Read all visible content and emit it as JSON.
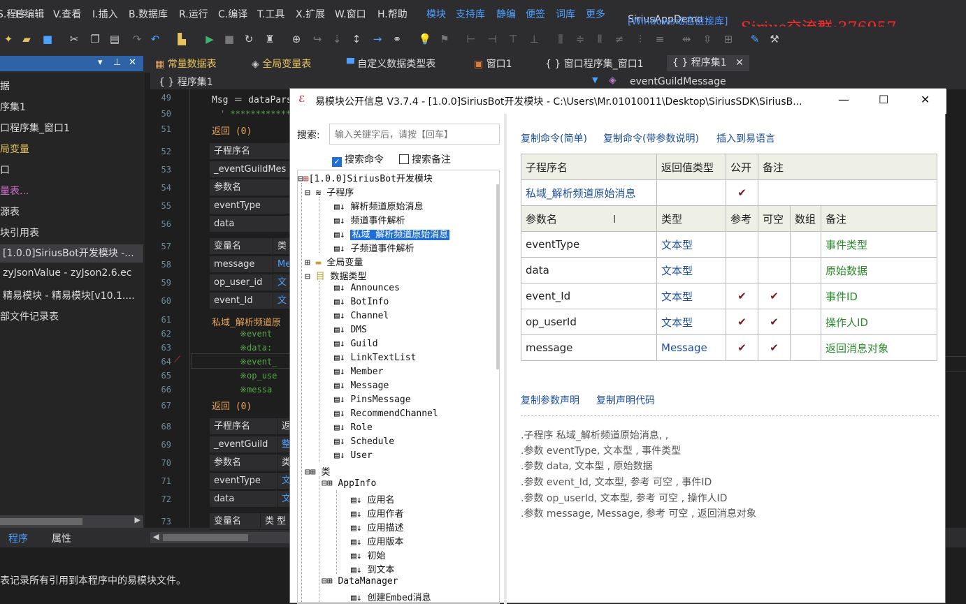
{
  "menu": [
    "S.程序",
    "E.编辑",
    "V.查看",
    "I.插入",
    "B.数据库",
    "R.运行",
    "C.编译",
    "T.工具",
    "X.扩展",
    "W.窗口",
    "H.帮助"
  ],
  "menu_ext": [
    "模块",
    "支持库",
    "静编",
    "便签",
    "词库",
    "更多"
  ],
  "app_title": "SiriusAppDemo - ",
  "app_mode": "[Windows动态链接库]",
  "watermark": "Sirius交流群:376957",
  "doc_tabs": [
    "常量数据表",
    "全局变量表",
    "自定义数据类型表",
    "窗口1",
    "窗口程序集_窗口1",
    "程序集1"
  ],
  "editor_header": {
    "left": "{ } 程序集1",
    "right": "eventGuildMessage"
  },
  "left_panel": [
    "据",
    "序集1",
    "口程序集_窗口1",
    "局变量",
    "口",
    "量表...",
    "源表",
    "块引用表",
    "[1.0.0]SiriusBot开发模块 -...",
    "zyJsonValue - zyJson2.6.ec",
    "精易模块 - 精易模块[v10.1....",
    "部文件记录表"
  ],
  "bottom_tabs": [
    "程序",
    "属性"
  ],
  "status_text": "表记录所有引用到本程序中的易模块文件。",
  "editor": {
    "line_numbers": [
      "49",
      "50",
      "51",
      "52",
      "53",
      "54",
      "55",
      "56",
      "57",
      "58",
      "59",
      "60",
      "61",
      "62",
      "63",
      "64",
      "65",
      "66",
      "67",
      "68",
      "69",
      "70",
      "71",
      "72",
      "73"
    ],
    "msg": "Msg ＝ dataPars",
    "stars": "' ***************",
    "return1": "返回 (0)",
    "sub_name_hdr": "子程序名",
    "sub1": "_eventGuildMes",
    "param_hdr": "参数名",
    "p1": "eventType",
    "p2": "data",
    "var_hdr": "变量名",
    "var_type": "类",
    "v1": "message",
    "v1t": "Me",
    "v2": "op_user_id",
    "v2t": "文",
    "v3": "event_Id",
    "v3t": "文",
    "call": "私域_解析频道原",
    "c1": "※event",
    "c2": "※data:",
    "c3": "※event_",
    "c4": "※op_use",
    "c5": "※messa",
    "return2": "返回 (0)",
    "sub_hdr2": "子程序名",
    "sub_hdr2b": "返",
    "sub2": "_eventGuild",
    "sub2t": "整",
    "param_hdr2": "参数名",
    "param_hdr2b": "类",
    "p3": "eventType",
    "p3t": "文",
    "p4": "data",
    "p4t": "文",
    "var_hdr2": "变量名",
    "var_hdr2b": "类 型"
  },
  "dialog": {
    "title": "易模块公开信息 V3.7.4 - [1.0.0]SiriusBot开发模块 - C:\\Users\\Mr.01010011\\Desktop\\SiriusSDK\\SiriusB...",
    "search_label": "搜索:",
    "search_placeholder": "输入关键字后，请按【回车】",
    "chk_cmd": "搜索命令",
    "chk_note": "搜索备注",
    "tree": {
      "root": "[1.0.0]SiriusBot开发模块",
      "subs": "子程序",
      "sub_items": [
        "解析频道原始消息",
        "频道事件解析",
        "私域_解析频道原始消息",
        "子频道事件解析"
      ],
      "globals": "全局变量",
      "types": "数据类型",
      "type_items": [
        "Announces",
        "BotInfo",
        "Channel",
        "DMS",
        "Guild",
        "LinkTextList",
        "Member",
        "Message",
        "PinsMessage",
        "RecommendChannel",
        "Role",
        "Schedule",
        "User"
      ],
      "classes": "类",
      "class1": "AppInfo",
      "class1_items": [
        "应用名",
        "应用作者",
        "应用描述",
        "应用版本",
        "初始",
        "到文本"
      ],
      "class2": "DataManager",
      "class2_items": [
        "创建Embed消息"
      ]
    },
    "links_top": [
      "复制命令(简单)",
      "复制命令(带参数说明)",
      "插入到易语言"
    ],
    "table": {
      "head1": [
        "子程序名",
        "返回值类型",
        "公开",
        "备注"
      ],
      "sub_name": "私域_解析频道原始消息",
      "sub_public": "✔",
      "head2": [
        "参数名",
        "类型",
        "参考",
        "可空",
        "数组",
        "备注"
      ],
      "params": [
        {
          "name": "eventType",
          "type": "文本型",
          "ref": "",
          "null": "",
          "note": "事件类型"
        },
        {
          "name": "data",
          "type": "文本型",
          "ref": "",
          "null": "",
          "note": "原始数据"
        },
        {
          "name": "event_Id",
          "type": "文本型",
          "ref": "✔",
          "null": "✔",
          "note": "事件ID"
        },
        {
          "name": "op_userId",
          "type": "文本型",
          "ref": "✔",
          "null": "✔",
          "note": "操作人ID"
        },
        {
          "name": "message",
          "type": "Message",
          "ref": "✔",
          "null": "✔",
          "note": "返回消息对象"
        }
      ]
    },
    "links_bottom": [
      "复制参数声明",
      "复制声明代码"
    ],
    "decl": [
      ".子程序 私域_解析频道原始消息, , ",
      ".参数 eventType, 文本型 , 事件类型",
      ".参数 data, 文本型 , 原始数据",
      ".参数 event_Id, 文本型, 参考 可空 , 事件ID",
      ".参数 op_userId, 文本型, 参考 可空 , 操作人ID",
      ".参数 message, Message, 参考 可空 , 返回消息对象"
    ]
  },
  "colors": {
    "accent": "#1e6fd9",
    "link": "#1c4fa0",
    "note_green": "#2a8a2a",
    "ide_bg": "#1e1e1e",
    "watermark": "#ff2a2a"
  }
}
